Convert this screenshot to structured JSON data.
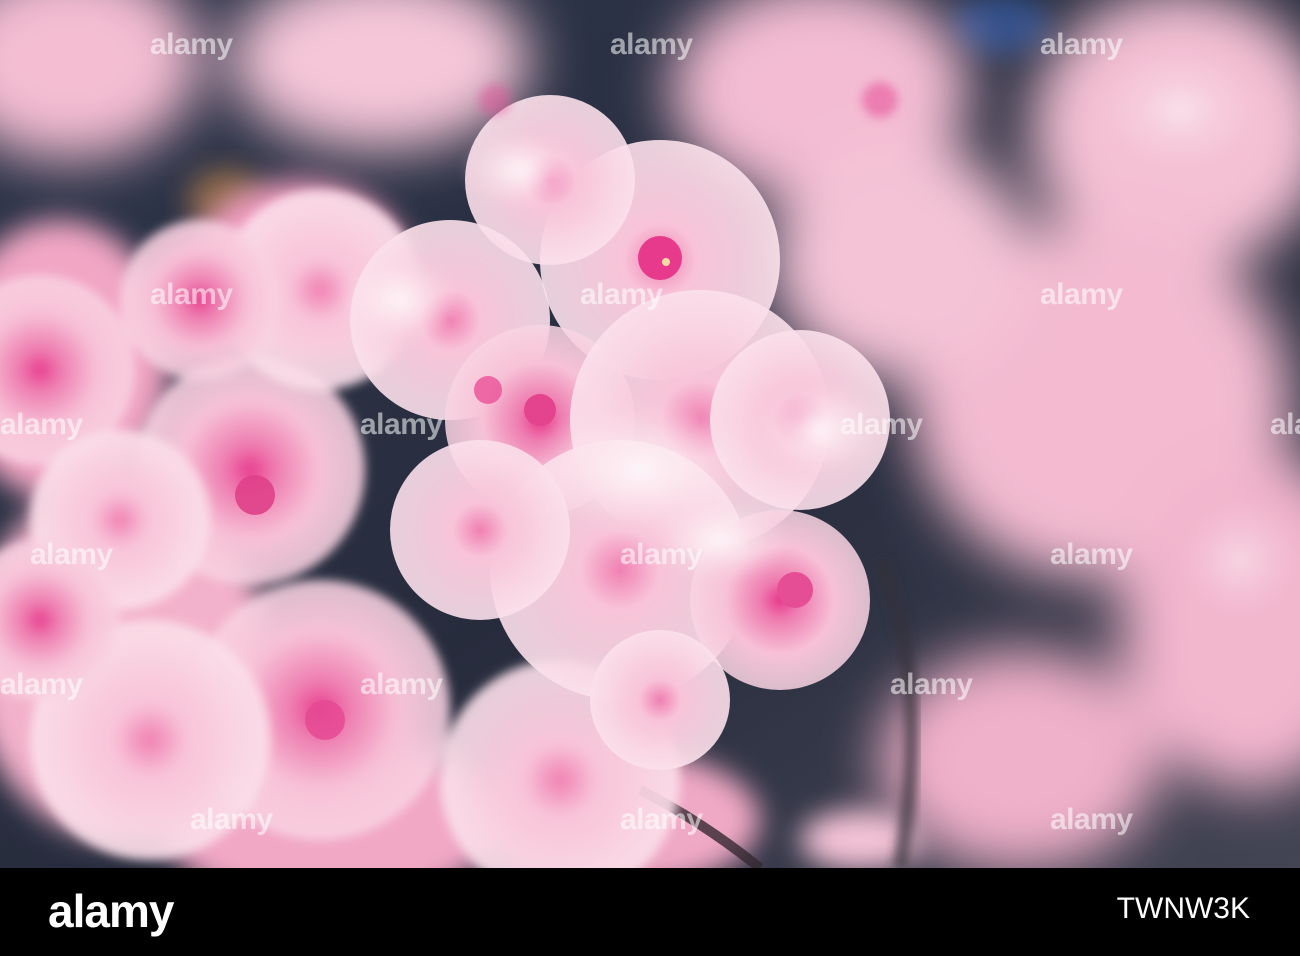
{
  "photo": {
    "subject": "pink-blossom-cluster",
    "colors": {
      "background_dark": "#1f2a3a",
      "petal_light": "#fbd3e2",
      "petal_mid": "#f49dbd",
      "petal_center": "#e8358a",
      "highlight": "#fff3f7"
    }
  },
  "watermarks": {
    "text": "alamy"
  },
  "footer": {
    "logo": "alamy",
    "image_id": "TWNW3K"
  }
}
